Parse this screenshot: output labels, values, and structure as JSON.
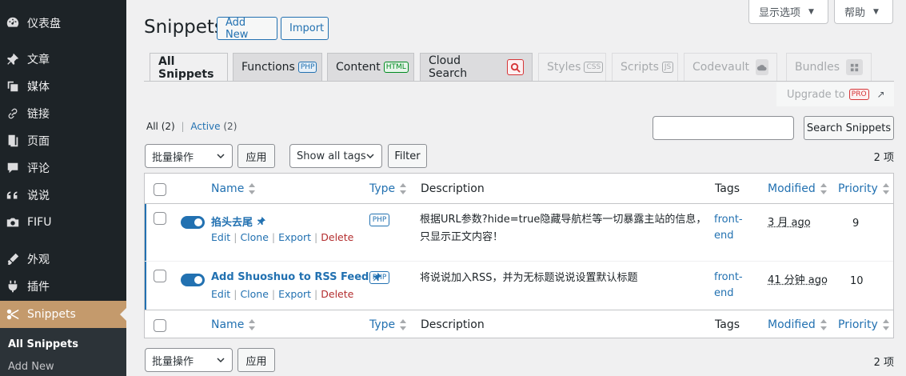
{
  "sidebar": {
    "items": [
      {
        "label": "仪表盘",
        "icon": "dashboard-icon"
      },
      {
        "label": "文章",
        "icon": "pin-icon"
      },
      {
        "label": "媒体",
        "icon": "media-icon"
      },
      {
        "label": "链接",
        "icon": "link-icon"
      },
      {
        "label": "页面",
        "icon": "page-icon"
      },
      {
        "label": "评论",
        "icon": "comment-icon"
      },
      {
        "label": "说说",
        "icon": "quote-icon"
      },
      {
        "label": "FIFU",
        "icon": "camera-icon"
      },
      {
        "label": "外观",
        "icon": "appearance-icon"
      },
      {
        "label": "插件",
        "icon": "plugin-icon"
      },
      {
        "label": "Snippets",
        "icon": "scissors-icon"
      }
    ],
    "submenu": [
      "All Snippets",
      "Add New"
    ]
  },
  "header": {
    "screen_options": "显示选项",
    "help": "帮助",
    "title": "Snippets",
    "add_new": "Add New",
    "import": "Import"
  },
  "tabs": [
    {
      "label": "All Snippets"
    },
    {
      "label": "Functions",
      "badge": "PHP"
    },
    {
      "label": "Content",
      "badge": "HTML"
    },
    {
      "label": "Cloud Search"
    },
    {
      "label": "Styles",
      "badge": "CSS"
    },
    {
      "label": "Scripts",
      "badge": "JS"
    },
    {
      "label": "Codevault"
    },
    {
      "label": "Bundles"
    }
  ],
  "upgrade": {
    "label": "Upgrade to",
    "badge": "PRO"
  },
  "filters": {
    "all": "All",
    "all_count": "(2)",
    "sep": "|",
    "active": "Active",
    "active_count": "(2)"
  },
  "search": {
    "placeholder": "",
    "button": "Search Snippets"
  },
  "bulk": {
    "select": "批量操作",
    "apply": "应用"
  },
  "tags_filter": {
    "select": "Show all tags",
    "button": "Filter"
  },
  "item_count": "2 项",
  "table": {
    "columns": {
      "name": "Name",
      "type": "Type",
      "description": "Description",
      "tags": "Tags",
      "modified": "Modified",
      "priority": "Priority"
    },
    "rows": [
      {
        "name": "掐头去尾",
        "actions": [
          "Edit",
          "Clone",
          "Export",
          "Delete"
        ],
        "type": "PHP",
        "description_line1": "根据URL参数?hide=true隐藏导航栏等一切暴露主站的信息，",
        "description_line2": "只显示正文内容！",
        "tags_line1": "front-",
        "tags_line2": "end",
        "modified": "3 月 ago",
        "priority": "9"
      },
      {
        "name": "Add Shuoshuo to RSS Feed",
        "actions": [
          "Edit",
          "Clone",
          "Export",
          "Delete"
        ],
        "type": "PHP",
        "description_line1": "将说说加入RSS，并为无标题说说设置默认标题",
        "description_line2": "",
        "tags_line1": "front-",
        "tags_line2": "end",
        "modified": "41 分钟 ago",
        "priority": "10"
      }
    ]
  },
  "colors": {
    "accent": "#2271b1",
    "sidebar_bg": "#1d2327",
    "active_menu": "#c49a6c",
    "delete": "#b32d2e"
  }
}
